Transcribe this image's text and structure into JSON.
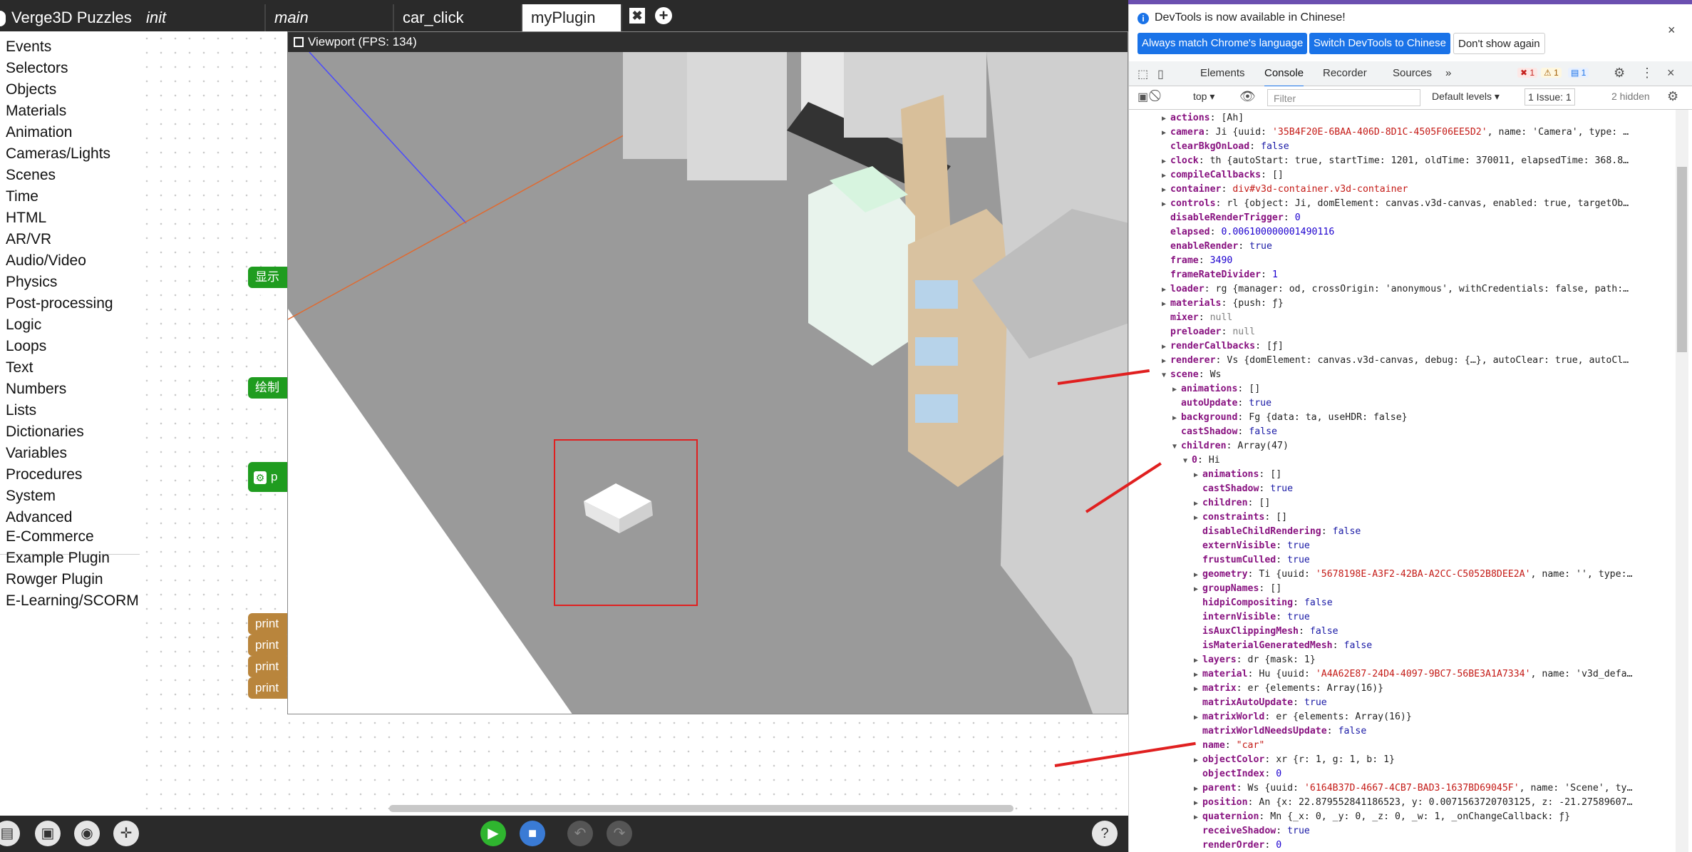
{
  "tabs": {
    "app_title": "Verge3D Puzzles",
    "items": [
      "init",
      "main",
      "car_click",
      "myPlugin"
    ],
    "close_glyph": "✖",
    "add_glyph": "+"
  },
  "categories": [
    "Events",
    "Selectors",
    "Objects",
    "Materials",
    "Animation",
    "Cameras/Lights",
    "Scenes",
    "Time",
    "HTML",
    "AR/VR",
    "Audio/Video",
    "Physics",
    "Post-processing",
    "Logic",
    "Loops",
    "Text",
    "Numbers",
    "Lists",
    "Dictionaries",
    "Variables",
    "Procedures",
    "System",
    "Advanced"
  ],
  "plugins": [
    "E-Commerce",
    "Example Plugin",
    "Rowger Plugin",
    "E-Learning/SCORM"
  ],
  "blocks": {
    "green1": "显示虫",
    "green2": "绘制一",
    "procedure": "p",
    "print": "print"
  },
  "viewport": {
    "title": "Viewport (FPS: 134)"
  },
  "bottombar": {
    "help": "?"
  },
  "devtools": {
    "banner": "DevTools is now available in Chinese!",
    "btn_match": "Always match Chrome's language",
    "btn_switch": "Switch DevTools to Chinese",
    "btn_dont": "Don't show again",
    "tabs": [
      "Elements",
      "Console",
      "Recorder",
      "Sources",
      "»"
    ],
    "errors": "1",
    "warnings": "1",
    "messages": "1",
    "context": "top",
    "filter_placeholder": "Filter",
    "levels": "Default levels",
    "issues": "1 Issue: 1",
    "hidden": "2 hidden"
  },
  "console_lines": [
    {
      "indent": 0,
      "arrow": "▶",
      "key": "actions",
      "rest": " [Ah]"
    },
    {
      "indent": 0,
      "arrow": "▶",
      "key": "camera",
      "rest": " Ji {uuid: ",
      "str": "'35B4F20E-6BAA-406D-8D1C-4505F06EE5D2'",
      "rest2": ", name: 'Camera', type: …"
    },
    {
      "indent": 0,
      "arrow": "",
      "key": "clearBkgOnLoad",
      "bool": " false"
    },
    {
      "indent": 0,
      "arrow": "▶",
      "key": "clock",
      "rest": " th {autoStart: true, startTime: 1201, oldTime: 370011, elapsedTime: 368.8…"
    },
    {
      "indent": 0,
      "arrow": "▶",
      "key": "compileCallbacks",
      "rest": " []"
    },
    {
      "indent": 0,
      "arrow": "▶",
      "key": "container",
      "str": " div#v3d-container.v3d-container"
    },
    {
      "indent": 0,
      "arrow": "▶",
      "key": "controls",
      "rest": " rl {object: Ji, domElement: canvas.v3d-canvas, enabled: true, targetOb…"
    },
    {
      "indent": 0,
      "arrow": "",
      "key": "disableRenderTrigger",
      "num": " 0"
    },
    {
      "indent": 0,
      "arrow": "",
      "key": "elapsed",
      "num": " 0.006100000001490116"
    },
    {
      "indent": 0,
      "arrow": "",
      "key": "enableRender",
      "bool": " true"
    },
    {
      "indent": 0,
      "arrow": "",
      "key": "frame",
      "num": " 3490"
    },
    {
      "indent": 0,
      "arrow": "",
      "key": "frameRateDivider",
      "num": " 1"
    },
    {
      "indent": 0,
      "arrow": "▶",
      "key": "loader",
      "rest": " rg {manager: od, crossOrigin: 'anonymous', withCredentials: false, path:…"
    },
    {
      "indent": 0,
      "arrow": "▶",
      "key": "materials",
      "rest": " {push: ƒ}"
    },
    {
      "indent": 0,
      "arrow": "",
      "key": "mixer",
      "nul": " null"
    },
    {
      "indent": 0,
      "arrow": "",
      "key": "preloader",
      "nul": " null"
    },
    {
      "indent": 0,
      "arrow": "▶",
      "key": "renderCallbacks",
      "rest": " [ƒ]"
    },
    {
      "indent": 0,
      "arrow": "▶",
      "key": "renderer",
      "rest": " Vs {domElement: canvas.v3d-canvas, debug: {…}, autoClear: true, autoCl…"
    },
    {
      "indent": 0,
      "arrow": "▼",
      "key": "scene",
      "rest": " Ws"
    },
    {
      "indent": 1,
      "arrow": "▶",
      "key": "animations",
      "rest": " []"
    },
    {
      "indent": 1,
      "arrow": "",
      "key": "autoUpdate",
      "bool": " true"
    },
    {
      "indent": 1,
      "arrow": "▶",
      "key": "background",
      "rest": " Fg {data: ta, useHDR: false}"
    },
    {
      "indent": 1,
      "arrow": "",
      "key": "castShadow",
      "bool": " false"
    },
    {
      "indent": 1,
      "arrow": "▼",
      "key": "children",
      "rest": " Array(47)"
    },
    {
      "indent": 2,
      "arrow": "▼",
      "key": "0",
      "rest": " Hi"
    },
    {
      "indent": 3,
      "arrow": "▶",
      "key": "animations",
      "rest": " []"
    },
    {
      "indent": 3,
      "arrow": "",
      "key": "castShadow",
      "bool": " true"
    },
    {
      "indent": 3,
      "arrow": "▶",
      "key": "children",
      "rest": " []"
    },
    {
      "indent": 3,
      "arrow": "▶",
      "key": "constraints",
      "rest": " []"
    },
    {
      "indent": 3,
      "arrow": "",
      "key": "disableChildRendering",
      "bool": " false"
    },
    {
      "indent": 3,
      "arrow": "",
      "key": "externVisible",
      "bool": " true"
    },
    {
      "indent": 3,
      "arrow": "",
      "key": "frustumCulled",
      "bool": " true"
    },
    {
      "indent": 3,
      "arrow": "▶",
      "key": "geometry",
      "rest": " Ti {uuid: ",
      "str": "'5678198E-A3F2-42BA-A2CC-C5052B8DEE2A'",
      "rest2": ", name: '', type:…"
    },
    {
      "indent": 3,
      "arrow": "▶",
      "key": "groupNames",
      "rest": " []"
    },
    {
      "indent": 3,
      "arrow": "",
      "key": "hidpiCompositing",
      "bool": " false"
    },
    {
      "indent": 3,
      "arrow": "",
      "key": "internVisible",
      "bool": " true"
    },
    {
      "indent": 3,
      "arrow": "",
      "key": "isAuxClippingMesh",
      "bool": " false"
    },
    {
      "indent": 3,
      "arrow": "",
      "key": "isMaterialGeneratedMesh",
      "bool": " false"
    },
    {
      "indent": 3,
      "arrow": "▶",
      "key": "layers",
      "rest": " dr {mask: 1}"
    },
    {
      "indent": 3,
      "arrow": "▶",
      "key": "material",
      "rest": " Hu {uuid: ",
      "str": "'A4A62E87-24D4-4097-9BC7-56BE3A1A7334'",
      "rest2": ", name: 'v3d_defa…"
    },
    {
      "indent": 3,
      "arrow": "▶",
      "key": "matrix",
      "rest": " er {elements: Array(16)}"
    },
    {
      "indent": 3,
      "arrow": "",
      "key": "matrixAutoUpdate",
      "bool": " true"
    },
    {
      "indent": 3,
      "arrow": "▶",
      "key": "matrixWorld",
      "rest": " er {elements: Array(16)}"
    },
    {
      "indent": 3,
      "arrow": "",
      "key": "matrixWorldNeedsUpdate",
      "bool": " false"
    },
    {
      "indent": 3,
      "arrow": "",
      "key": "name",
      "str": " \"car\""
    },
    {
      "indent": 3,
      "arrow": "▶",
      "key": "objectColor",
      "rest": " xr {r: 1, g: 1, b: 1}"
    },
    {
      "indent": 3,
      "arrow": "",
      "key": "objectIndex",
      "num": " 0"
    },
    {
      "indent": 3,
      "arrow": "▶",
      "key": "parent",
      "rest": " Ws {uuid: ",
      "str": "'6164B37D-4667-4CB7-BAD3-1637BD69045F'",
      "rest2": ", name: 'Scene', ty…"
    },
    {
      "indent": 3,
      "arrow": "▶",
      "key": "position",
      "rest": " An {x: 22.879552841186523, y: 0.0071563720703125, z: -21.27589607…"
    },
    {
      "indent": 3,
      "arrow": "▶",
      "key": "quaternion",
      "rest": " Mn {_x: 0, _y: 0, _z: 0, _w: 1, _onChangeCallback: ƒ}"
    },
    {
      "indent": 3,
      "arrow": "",
      "key": "receiveShadow",
      "bool": " true"
    },
    {
      "indent": 3,
      "arrow": "",
      "key": "renderOrder",
      "num": " 0"
    }
  ]
}
